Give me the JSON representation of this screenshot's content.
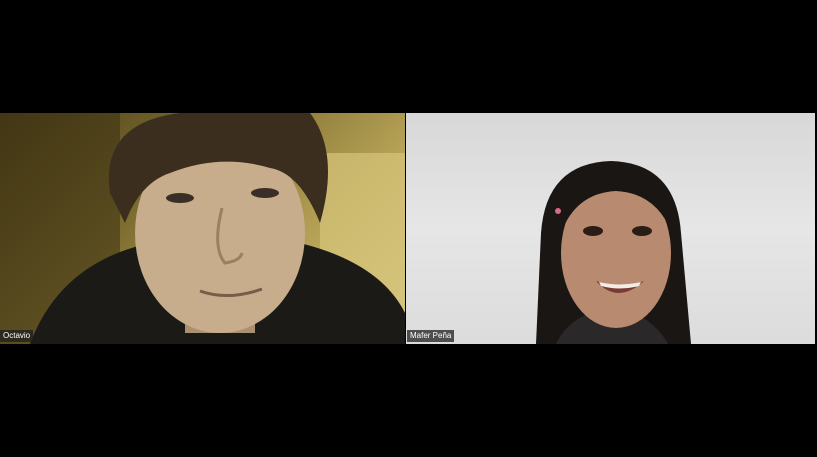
{
  "meeting": {
    "participants": [
      {
        "name": "Octavio"
      },
      {
        "name": "Mafer Peña"
      }
    ]
  },
  "colors": {
    "background": "#000000",
    "name_tag_bg": "#1e1e1e",
    "name_tag_text": "#ffffff"
  }
}
